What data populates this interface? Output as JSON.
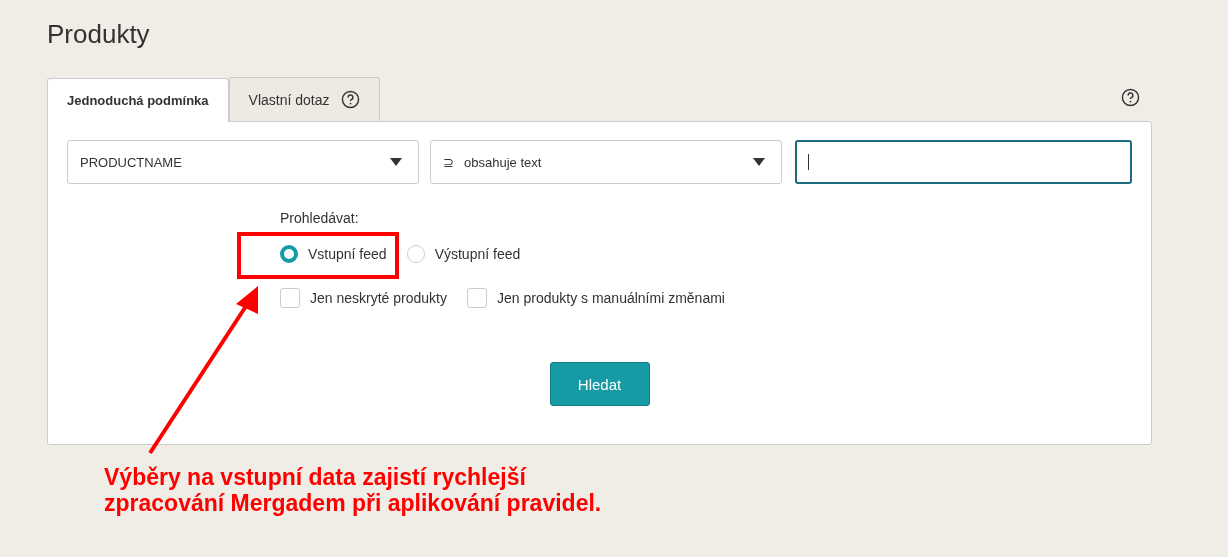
{
  "page_title": "Produkty",
  "tabs": [
    {
      "label": "Jednoduchá podmínka",
      "selected": true,
      "help": false
    },
    {
      "label": "Vlastní dotaz",
      "selected": false,
      "help": true
    }
  ],
  "filter": {
    "field": "PRODUCTNAME",
    "operator_symbol": "⊇",
    "operator": "obsahuje text",
    "value_focused": true
  },
  "search_in": {
    "label": "Prohledávat:",
    "options": [
      {
        "label": "Vstupní feed",
        "selected": true
      },
      {
        "label": "Výstupní feed",
        "selected": false
      }
    ]
  },
  "checkboxes": [
    {
      "label": "Jen neskryté produkty",
      "checked": false
    },
    {
      "label": "Jen produkty s manuálními změnami",
      "checked": false
    }
  ],
  "search_button": "Hledat",
  "annotation": {
    "lines": [
      "Výběry na vstupní data zajistí rychlejší",
      "zpracování Mergadem při aplikování pravidel."
    ]
  }
}
